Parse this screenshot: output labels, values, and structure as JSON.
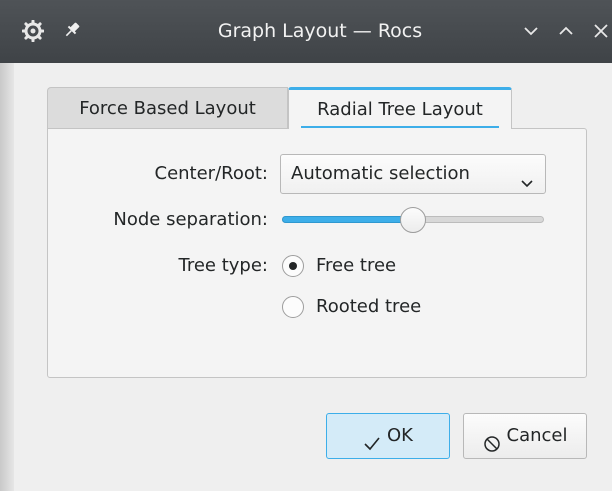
{
  "window": {
    "title": "Graph Layout — Rocs",
    "icons": [
      "rocs-app-icon",
      "pin-icon",
      "minimize-icon",
      "maximize-icon",
      "close-icon"
    ]
  },
  "tabs": [
    {
      "label": "Force Based Layout",
      "active": false
    },
    {
      "label": "Radial Tree Layout",
      "active": true
    }
  ],
  "form": {
    "center_root_label": "Center/Root:",
    "center_root_value": "Automatic selection",
    "node_separation_label": "Node separation:",
    "node_separation_level": 0.5,
    "tree_type_label": "Tree type:",
    "tree_type_options": [
      {
        "label": "Free tree",
        "checked": true
      },
      {
        "label": "Rooted tree",
        "checked": false
      }
    ]
  },
  "buttons": {
    "ok_label": "OK",
    "cancel_label": "Cancel"
  },
  "colors": {
    "accent": "#3daee9",
    "titlebar": "#474b4f",
    "window_bg": "#efefef"
  }
}
